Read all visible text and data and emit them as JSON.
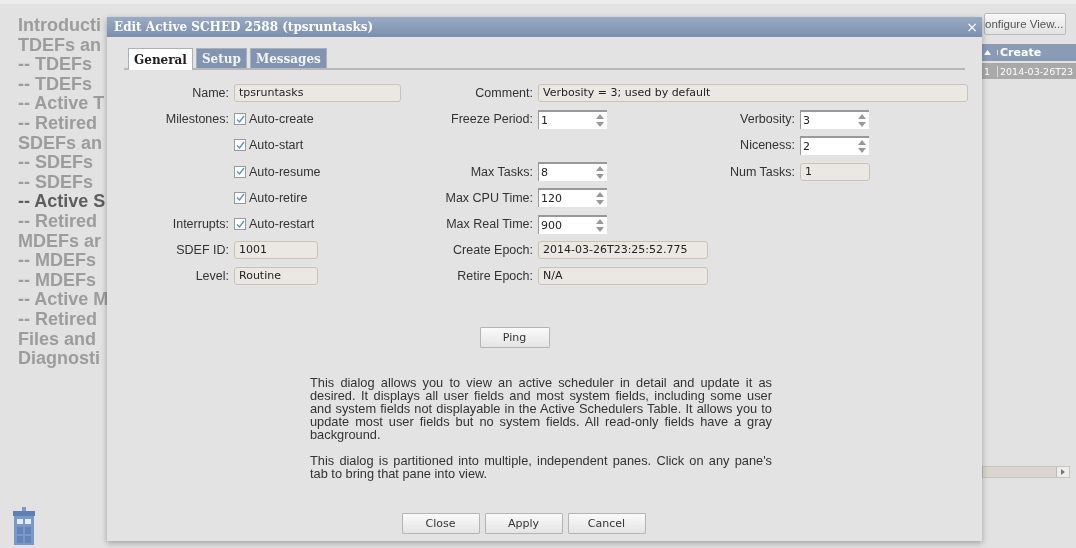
{
  "background": {
    "nav": [
      {
        "label": "Introducti",
        "selected": false
      },
      {
        "label": "TDEFs an",
        "selected": false
      },
      {
        "label": "-- TDEFs",
        "selected": false
      },
      {
        "label": "-- TDEFs",
        "selected": false
      },
      {
        "label": "-- Active T",
        "selected": false
      },
      {
        "label": "-- Retired",
        "selected": false
      },
      {
        "label": "SDEFs an",
        "selected": false
      },
      {
        "label": "-- SDEFs",
        "selected": false
      },
      {
        "label": "-- SDEFs",
        "selected": false
      },
      {
        "label": "-- Active S",
        "selected": true
      },
      {
        "label": "-- Retired",
        "selected": false
      },
      {
        "label": "MDEFs ar",
        "selected": false
      },
      {
        "label": "-- MDEFs",
        "selected": false
      },
      {
        "label": "-- MDEFs",
        "selected": false
      },
      {
        "label": "-- Active M",
        "selected": false
      },
      {
        "label": "-- Retired",
        "selected": false
      },
      {
        "label": "Files and",
        "selected": false
      },
      {
        "label": "Diagnosti",
        "selected": false
      }
    ],
    "configure_button": "onfigure View...",
    "table": {
      "columns": [
        "",
        "Create"
      ],
      "rows": [
        [
          "1",
          "2014-03-26T23"
        ]
      ]
    }
  },
  "dialog": {
    "title": "Edit Active SCHED 2588 (tpsruntasks)",
    "close": "×",
    "tabs": [
      {
        "label": "General",
        "selected": true
      },
      {
        "label": "Setup",
        "selected": false
      },
      {
        "label": "Messages",
        "selected": false
      }
    ],
    "fields": [
      {
        "label": "Name:",
        "kind": "readonly",
        "value": "tpsruntasks"
      },
      {
        "label": "Comment:",
        "kind": "readonly",
        "value": "Verbosity = 3; used by default"
      },
      {
        "label": "Milestones:",
        "kind": "checks",
        "options": [
          {
            "label": "Auto-create",
            "checked": true
          },
          {
            "label": "Auto-start",
            "checked": true
          },
          {
            "label": "Auto-resume",
            "checked": true
          },
          {
            "label": "Auto-retire",
            "checked": true
          }
        ]
      },
      {
        "label": "Interrupts:",
        "kind": "checks",
        "options": [
          {
            "label": "Auto-restart",
            "checked": true
          }
        ]
      },
      {
        "label": "SDEF ID:",
        "kind": "readonly",
        "value": "1001"
      },
      {
        "label": "Level:",
        "kind": "readonly",
        "value": "Routine"
      },
      {
        "label": "Freeze Period:",
        "kind": "spinner",
        "value": "1"
      },
      {
        "label": "Max Tasks:",
        "kind": "spinner",
        "value": "8"
      },
      {
        "label": "Max CPU Time:",
        "kind": "spinner",
        "value": "120"
      },
      {
        "label": "Max Real Time:",
        "kind": "spinner",
        "value": "900"
      },
      {
        "label": "Create Epoch:",
        "kind": "readonly",
        "value": "2014-03-26T23:25:52.775"
      },
      {
        "label": "Retire Epoch:",
        "kind": "readonly",
        "value": "N/A"
      },
      {
        "label": "Verbosity:",
        "kind": "spinner",
        "value": "3"
      },
      {
        "label": "Niceness:",
        "kind": "spinner",
        "value": "2"
      },
      {
        "label": "Num Tasks:",
        "kind": "readonly",
        "value": "1"
      }
    ],
    "ping_button": "Ping",
    "description": [
      "This dialog allows you to view an active scheduler in detail and update it as desired. It displays all user fields and most system fields, including some user and system fields not displayable in the Active Schedulers Table. It allows you to update most user fields but no system fields. All read-only fields have a gray background.",
      "This dialog is partitioned into multiple, independent panes. Click on any pane's tab to bring that pane into view."
    ],
    "buttons": [
      "Close",
      "Apply",
      "Cancel"
    ]
  }
}
